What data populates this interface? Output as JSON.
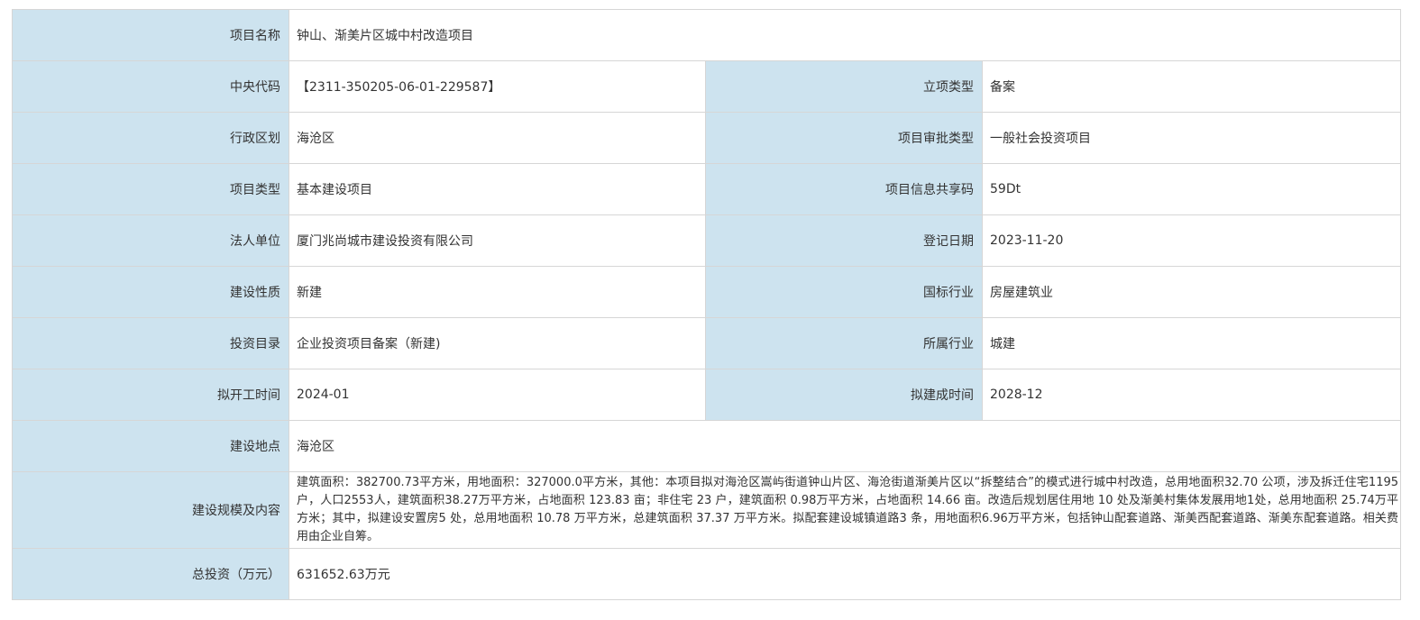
{
  "project": {
    "name_label": "项目名称",
    "name_value": "钟山、渐美片区城中村改造项目",
    "central_code_label": "中央代码",
    "central_code_value": "【2311-350205-06-01-229587】",
    "approval_type_label": "立项类型",
    "approval_type_value": "备案",
    "admin_region_label": "行政区划",
    "admin_region_value": "海沧区",
    "review_type_label": "项目审批类型",
    "review_type_value": "一般社会投资项目",
    "project_type_label": "项目类型",
    "project_type_value": "基本建设项目",
    "share_code_label": "项目信息共享码",
    "share_code_value": "59Dt",
    "legal_entity_label": "法人单位",
    "legal_entity_value": "厦门兆尚城市建设投资有限公司",
    "register_date_label": "登记日期",
    "register_date_value": "2023-11-20",
    "construction_nature_label": "建设性质",
    "construction_nature_value": "新建",
    "national_industry_label": "国标行业",
    "national_industry_value": "房屋建筑业",
    "investment_catalog_label": "投资目录",
    "investment_catalog_value": "企业投资项目备案（新建)",
    "industry_label": "所属行业",
    "industry_value": "城建",
    "start_time_label": "拟开工时间",
    "start_time_value": "2024-01",
    "finish_time_label": "拟建成时间",
    "finish_time_value": "2028-12",
    "location_label": "建设地点",
    "location_value": "海沧区",
    "scale_label": "建设规模及内容",
    "scale_value": "建筑面积：382700.73平方米，用地面积：327000.0平方米，其他：本项目拟对海沧区嵩屿街道钟山片区、海沧街道渐美片区以“拆整结合”的模式进行城中村改造，总用地面积32.70 公项，涉及拆迁住宅1195户，人口2553人，建筑面积38.27万平方米，占地面积 123.83 亩；非住宅 23 户，建筑面积 0.98万平方米，占地面积 14.66 亩。改造后规划居住用地 10 处及渐美村集体发展用地1处，总用地面积 25.74万平方米；其中，拟建设安置房5 处，总用地面积 10.78 万平方米，总建筑面积 37.37 万平方米。拟配套建设城镇道路3 条，用地面积6.96万平方米，包括钟山配套道路、渐美西配套道路、渐美东配套道路。相关费用由企业自筹。",
    "total_investment_label": "总投资（万元）",
    "total_investment_value": "631652.63万元"
  }
}
